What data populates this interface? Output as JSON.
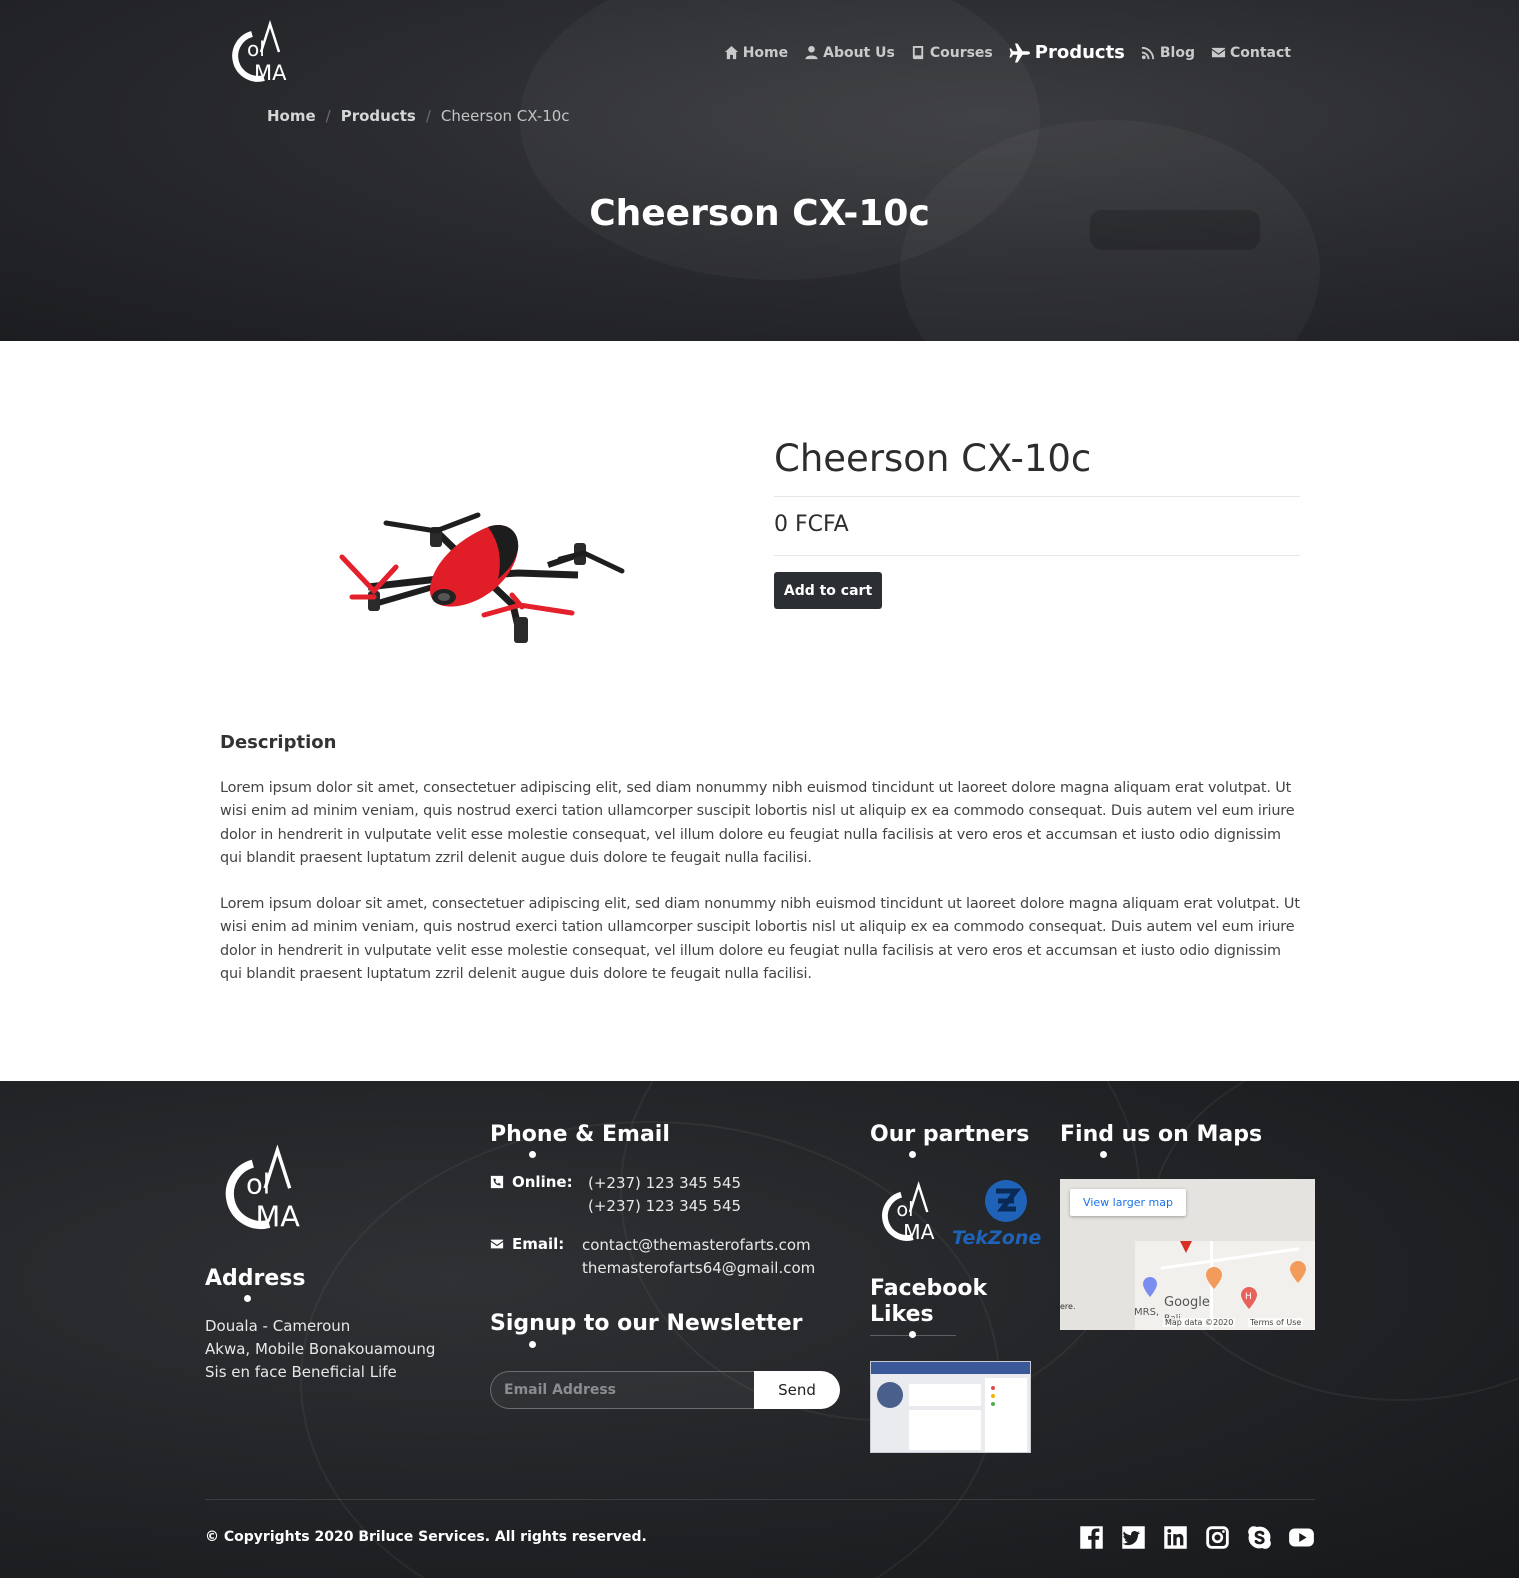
{
  "nav": {
    "items": [
      {
        "label": "Home",
        "icon": "home-icon"
      },
      {
        "label": "About Us",
        "icon": "user-icon"
      },
      {
        "label": "Courses",
        "icon": "book-icon"
      },
      {
        "label": "Products",
        "icon": "plane-icon",
        "active": true
      },
      {
        "label": "Blog",
        "icon": "rss-icon"
      },
      {
        "label": "Contact",
        "icon": "envelope-icon"
      }
    ]
  },
  "breadcrumb": {
    "home": "Home",
    "products": "Products",
    "current": "Cheerson CX-10c",
    "separator": "/"
  },
  "hero": {
    "title": "Cheerson CX-10c"
  },
  "product": {
    "name": "Cheerson CX-10c",
    "price": "0 FCFA",
    "add_to_cart": "Add to cart",
    "image": "red-quadcopter-drone"
  },
  "description": {
    "heading": "Description",
    "paragraphs": [
      "Lorem ipsum dolor sit amet, consectetuer adipiscing elit, sed diam nonummy nibh euismod tincidunt ut laoreet dolore magna aliquam erat volutpat. Ut wisi enim ad minim veniam, quis nostrud exerci tation ullamcorper suscipit lobortis nisl ut aliquip ex ea commodo consequat. Duis autem vel eum iriure dolor in hendrerit in vulputate velit esse molestie consequat, vel illum dolore eu feugiat nulla facilisis at vero eros et accumsan et iusto odio dignissim qui blandit praesent luptatum zzril delenit augue duis dolore te feugait nulla facilisi.",
      "Lorem ipsum doloar sit amet, consectetuer adipiscing elit, sed diam nonummy nibh euismod tincidunt ut laoreet dolore magna aliquam erat volutpat. Ut wisi enim ad minim veniam, quis nostrud exerci tation ullamcorper suscipit lobortis nisl ut aliquip ex ea commodo consequat. Duis autem vel eum iriure dolor in hendrerit in vulputate velit esse molestie consequat, vel illum dolore eu feugiat nulla facilisis at vero eros et accumsan et iusto odio dignissim qui blandit praesent luptatum zzril delenit augue duis dolore te feugait nulla facilisi."
    ]
  },
  "footer": {
    "address": {
      "heading": "Address",
      "lines": [
        "Douala - Cameroun",
        "Akwa, Mobile Bonakouamoung",
        "Sis en face Beneficial Life"
      ]
    },
    "contact": {
      "heading": "Phone & Email",
      "online_label": "Online:",
      "phones": [
        "(+237) 123 345 545",
        "(+237) 123 345 545"
      ],
      "email_label": "Email:",
      "emails": [
        "contact@themasterofarts.com",
        "themasterofarts64@gmail.com"
      ]
    },
    "newsletter": {
      "heading": "Signup to our Newsletter",
      "placeholder": "Email Address",
      "button": "Send"
    },
    "partners": {
      "heading": "Our partners",
      "logo2_text": "TekZone"
    },
    "facebook": {
      "heading_line1": "Facebook",
      "heading_line2": "Likes"
    },
    "maps": {
      "heading": "Find us on Maps",
      "larger_map": "View larger map",
      "google": "Google",
      "map_data": "Map data ©2020",
      "terms": "Terms of Use",
      "label_mrs": "MRS,",
      "label_bali": "Bali",
      "label_ere": "ere."
    },
    "copyright_prefix": "© Copyrights 2020 ",
    "copyright_brand": "Briluce Services",
    "copyright_suffix": ". All rights reserved.",
    "socials": [
      "facebook-icon",
      "twitter-icon",
      "linkedin-icon",
      "instagram-icon",
      "skype-icon",
      "youtube-icon"
    ]
  },
  "colors": {
    "hero_bg": "#2a2b2f",
    "button_dark": "#2b2e33",
    "footer_bg": "#222427",
    "map_link": "#1a73e8",
    "tekzone_blue": "#1f63b8"
  }
}
